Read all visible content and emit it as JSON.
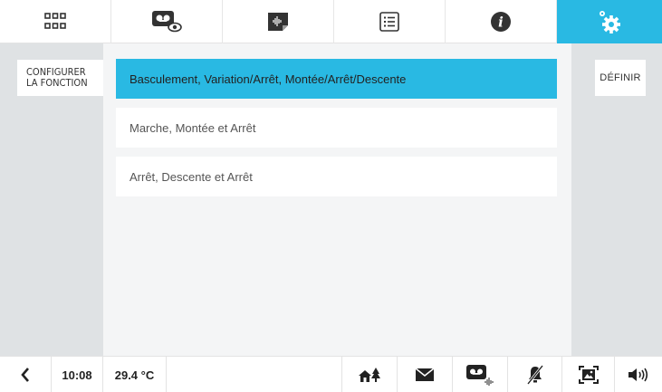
{
  "tabs": [
    {
      "name": "apps-grid-icon"
    },
    {
      "name": "videophone-view-icon"
    },
    {
      "name": "voice-memo-icon"
    },
    {
      "name": "list-icon"
    },
    {
      "name": "info-icon"
    },
    {
      "name": "settings-gear-icon",
      "active": true
    }
  ],
  "accent_color": "#29b9e3",
  "left": {
    "configure_label_line1": "CONFIGURER",
    "configure_label_line2": "LA FONCTION"
  },
  "right": {
    "define_label": "DÉFINIR"
  },
  "options": [
    {
      "label": "Basculement, Variation/Arrêt, Montée/Arrêt/Descente",
      "selected": true
    },
    {
      "label": "Marche, Montée et Arrêt",
      "selected": false
    },
    {
      "label": "Arrêt, Descente et Arrêt",
      "selected": false
    }
  ],
  "status": {
    "time": "10:08",
    "temperature": "29.4 °C",
    "icons": [
      "back-chevron-icon",
      "house-away-icon",
      "mail-icon",
      "answering-machine-icon",
      "bell-muted-icon",
      "picture-frame-icon",
      "speaker-volume-icon"
    ]
  }
}
